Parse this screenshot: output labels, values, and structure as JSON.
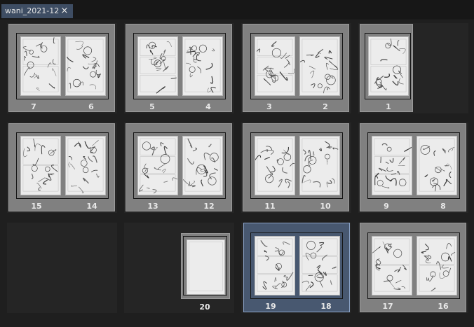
{
  "tab": {
    "title": "wani_2021-12",
    "close_glyph": "×"
  },
  "rows": [
    [
      {
        "left": "7",
        "right": "6"
      },
      {
        "left": "5",
        "right": "4"
      },
      {
        "left": "3",
        "right": "2"
      },
      {
        "left": "",
        "right": "1"
      }
    ],
    [
      {
        "left": "15",
        "right": "14"
      },
      {
        "left": "13",
        "right": "12"
      },
      {
        "left": "11",
        "right": "10"
      },
      {
        "left": "9",
        "right": "8"
      }
    ],
    [
      {
        "left": "",
        "right": ""
      },
      {
        "left": "20",
        "right": ""
      },
      {
        "left": "19",
        "right": "18"
      },
      {
        "left": "17",
        "right": "16"
      }
    ]
  ],
  "selected_spread": "19-18",
  "colors": {
    "selected": "#485870",
    "spread": "#808080",
    "background": "#1f1f1f"
  }
}
